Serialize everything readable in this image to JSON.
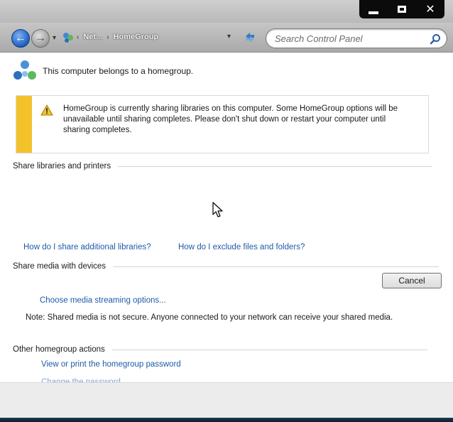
{
  "window": {
    "controls": [
      "minimize",
      "maximize",
      "close"
    ]
  },
  "navbar": {
    "back_icon": "back-arrow-icon",
    "forward_icon": "forward-arrow-icon",
    "breadcrumbs": [
      "Net...",
      "HomeGroup"
    ],
    "search": {
      "placeholder": "Search Control Panel"
    }
  },
  "content": {
    "header_text": "This computer belongs to a homegroup.",
    "warning": {
      "text": "HomeGroup is currently sharing libraries on this computer. Some HomeGroup options will be unavailable until sharing completes. Please don't shut down or restart your computer until sharing completes.",
      "bar_color": "#f3c22b"
    },
    "sections": {
      "libraries": "Share libraries and printers",
      "media": "Share media with devices",
      "other": "Other homegroup actions"
    },
    "links": {
      "share_additional": "How do I share additional libraries?",
      "exclude_files": "How do I exclude files and folders?",
      "media_streaming": "Choose media streaming options...",
      "view_password": "View or print the homegroup password",
      "change_password": "Change the password..."
    },
    "cancel_label": "Cancel",
    "note": "Note: Shared media is not secure. Anyone connected to your network can receive your shared media."
  },
  "colors": {
    "link": "#1f5aa8",
    "accent": "#1f5fc0"
  }
}
